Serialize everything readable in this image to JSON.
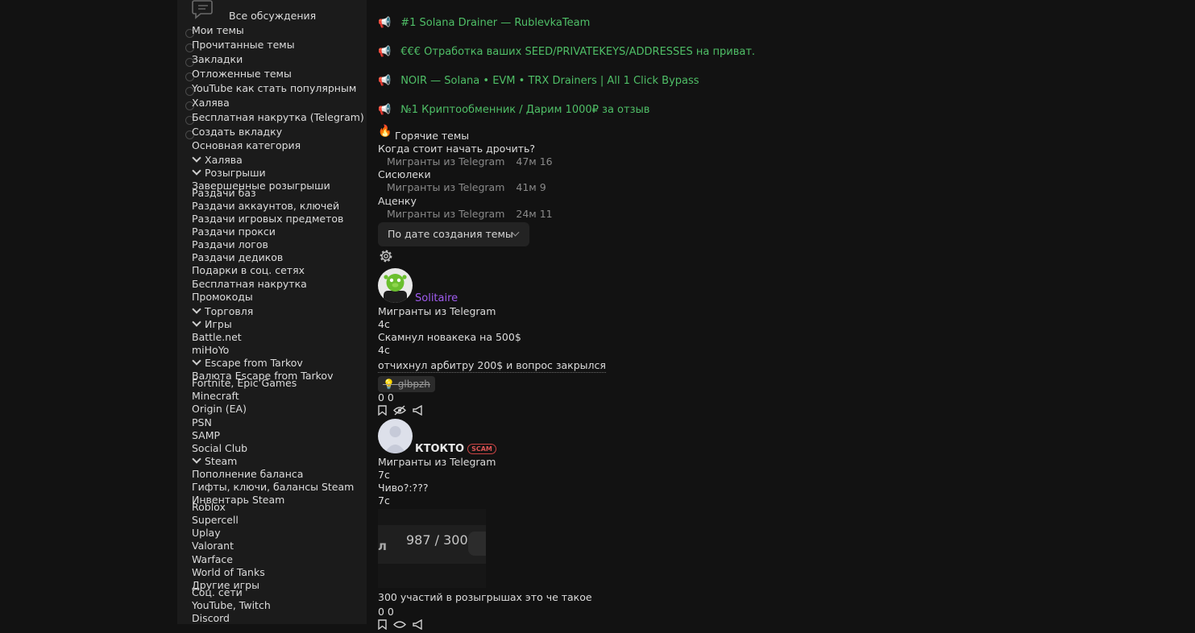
{
  "sidebar": {
    "all_discussions": "Все обсуждения",
    "top_items": [
      "Мои темы",
      "Прочитанные темы",
      "Закладки",
      "Отложенные темы",
      "YouTube как стать популярным",
      "Халява",
      "Бесплатная накрутка (Telegram)",
      "Создать вкладку"
    ],
    "category_title": "Основная категория",
    "halyava": "Халява",
    "rozygryshi": "Розыгрыши",
    "zavershennye": "Завершенные розыгрыши",
    "razdachi": [
      "Раздачи баз",
      "Раздачи аккаунтов, ключей",
      "Раздачи игровых предметов",
      "Раздачи прокси",
      "Раздачи логов",
      "Раздачи дедиков",
      "Подарки в соц. сетях",
      "Бесплатная накрутка",
      "Промокоды"
    ],
    "torgovlya": "Торговля",
    "igry": "Игры",
    "games_a": [
      "Battle.net",
      "miHoYo"
    ],
    "escape": "Escape from Tarkov",
    "escape_currency": "Валюта Escape from Tarkov",
    "fortnite": "Fortnite, Epic Games",
    "games_b": [
      "Minecraft",
      "Origin (EA)",
      "PSN",
      "SAMP",
      "Social Club"
    ],
    "steam": "Steam",
    "steam_items": [
      "Пополнение баланса",
      "Гифты, ключи, балансы Steam",
      "Инвентарь Steam"
    ],
    "roblox": "Roblox",
    "games_c": [
      "Supercell",
      "Uplay",
      "Valorant",
      "Warface",
      "World of Tanks",
      "Другие игры"
    ],
    "soc": "Соц. сети",
    "soc_items": [
      "YouTube, Twitch",
      "Discord"
    ]
  },
  "promos": [
    "#1 Solana Drainer — RublevkaTeam",
    "€€€ Отработка ваших SEED/PRIVATEKEYS/ADDRESSES на приват.",
    "NOIR — Solana • EVM • TRX Drainers | All 1 Click Bypass",
    "№1 Криптообменник / Дарим 1000₽ за отзыв"
  ],
  "hot": {
    "title": "Горячие темы",
    "topics": [
      {
        "title": "Когда стоит начать дрочить?",
        "forum": "Мигранты из Telegram",
        "time": "47м",
        "count": "16"
      },
      {
        "title": "Сисюлеки",
        "forum": "Мигранты из Telegram",
        "time": "41м",
        "count": "9"
      },
      {
        "title": "Аценку",
        "forum": "Мигранты из Telegram",
        "time": "24м",
        "count": "11"
      }
    ]
  },
  "sort": {
    "label": "По дате создания темы"
  },
  "thread1": {
    "author": "Solitaire",
    "forum": "Мигранты из Telegram",
    "time1": "4с",
    "title": "Скамнул новакека на 500$",
    "time2": "4с",
    "snippet": "отчихнул арбитру 200$ и вопрос закрылся",
    "tag": "glbpzh",
    "counts": "0 0"
  },
  "thread2": {
    "author": "КТОКТО",
    "badge": "SCAM",
    "forum": "Мигранты из Telegram",
    "time1": "7с",
    "title": "Чиво?:???",
    "time2": "7с",
    "preview_left": "л",
    "preview_value": "987 / 300",
    "snippet": "300 участий в розыгрышах это че такое",
    "counts": "0 0"
  },
  "colors": {
    "accent_green": "#4fbf67",
    "author_purple": "#a05cf0",
    "scam_red": "#d55"
  }
}
